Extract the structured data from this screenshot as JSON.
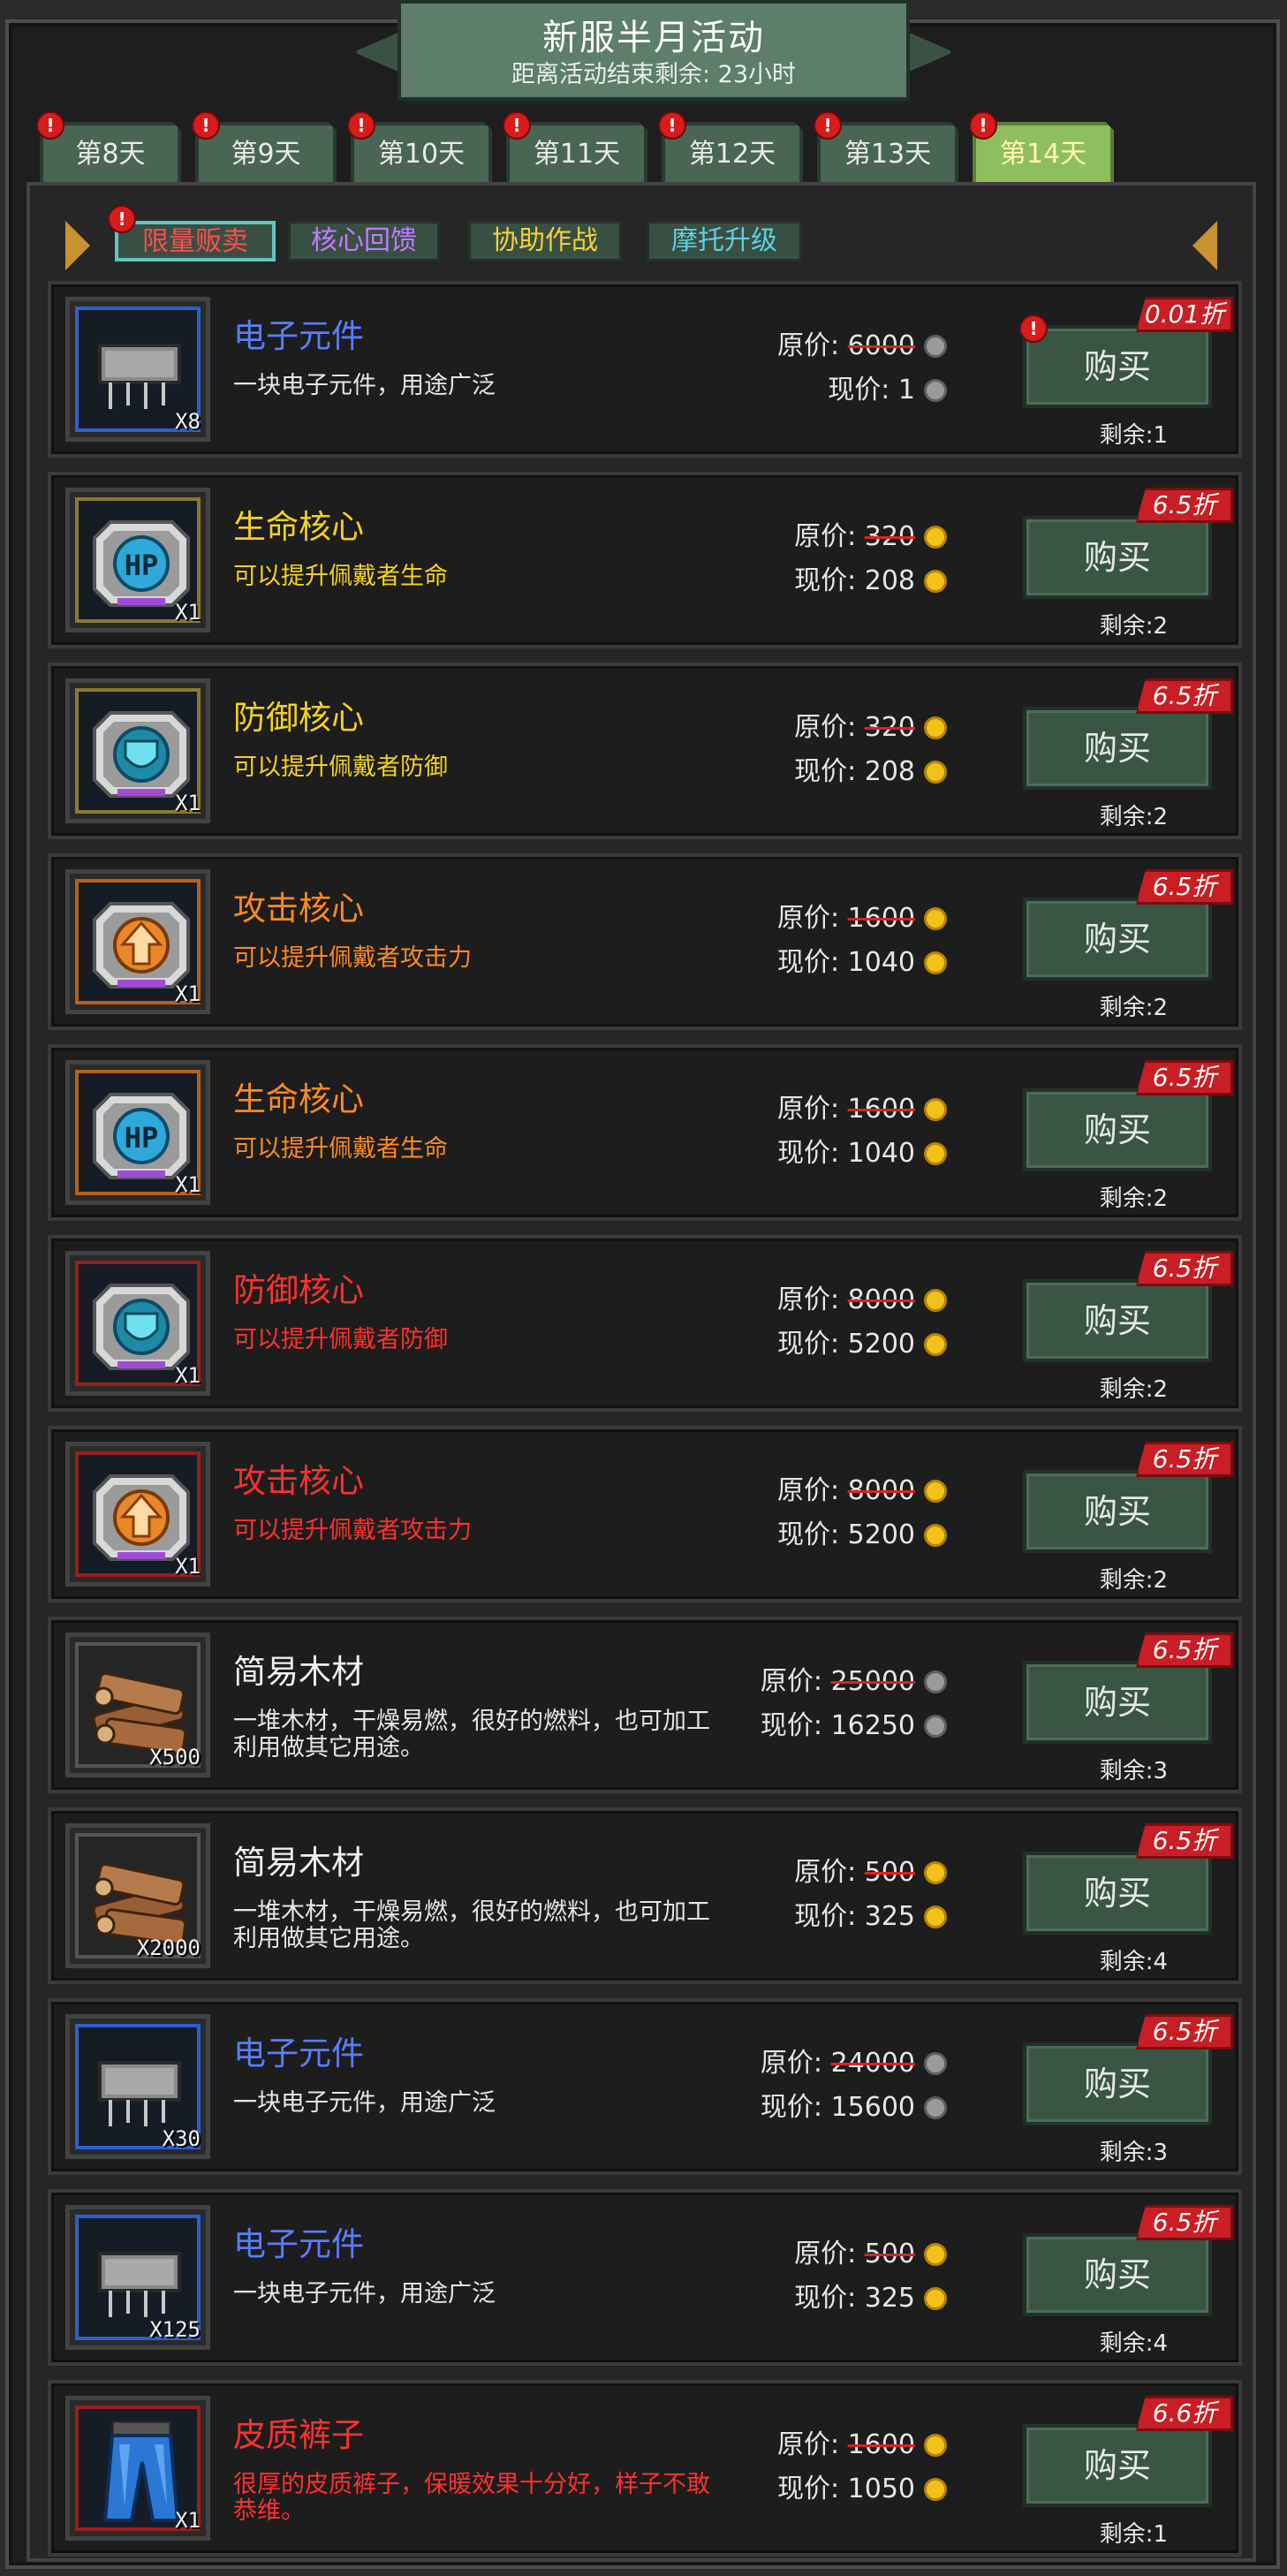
{
  "header": {
    "title": "新服半月活动",
    "subtitle": "距离活动结束剩余: 23小时"
  },
  "day_tabs": [
    {
      "label": "第8天",
      "active": false
    },
    {
      "label": "第9天",
      "active": false
    },
    {
      "label": "第10天",
      "active": false
    },
    {
      "label": "第11天",
      "active": false
    },
    {
      "label": "第12天",
      "active": false
    },
    {
      "label": "第13天",
      "active": false
    },
    {
      "label": "第14天",
      "active": true
    }
  ],
  "badge_symbol": "!",
  "sub_tabs": [
    {
      "label": "限量贩卖",
      "color": "#ff4d4d",
      "active": true
    },
    {
      "label": "核心回馈",
      "color": "#c07bff",
      "active": false
    },
    {
      "label": "协助作战",
      "color": "#f2d23a",
      "active": false
    },
    {
      "label": "摩托升级",
      "color": "#5fd0e0",
      "active": false
    }
  ],
  "labels": {
    "original_price": "原价:",
    "current_price": "现价:",
    "buy": "购买",
    "remaining": "剩余:"
  },
  "items": [
    {
      "name": "电子元件",
      "desc": "一块电子元件，用途广泛",
      "color": "#5b7cff",
      "icon": "chip-icon",
      "frame": "#2c5fcf",
      "qty": "X8",
      "original": "6000",
      "current": "1",
      "coin": "silver",
      "discount": "0.01折",
      "remaining": "1",
      "alert": true
    },
    {
      "name": "生命核心",
      "desc": "可以提升佩戴者生命",
      "color": "#f1d21c",
      "icon": "hp-core-icon",
      "frame": "#8a7a2c",
      "qty": "X1",
      "original": "320",
      "current": "208",
      "coin": "gold",
      "discount": "6.5折",
      "remaining": "2",
      "alert": false
    },
    {
      "name": "防御核心",
      "desc": "可以提升佩戴者防御",
      "color": "#f1d21c",
      "icon": "defense-core-icon",
      "frame": "#8a7a2c",
      "qty": "X1",
      "original": "320",
      "current": "208",
      "coin": "gold",
      "discount": "6.5折",
      "remaining": "2",
      "alert": false
    },
    {
      "name": "攻击核心",
      "desc": "可以提升佩戴者攻击力",
      "color": "#ff8a1e",
      "icon": "attack-core-icon",
      "frame": "#b5601c",
      "qty": "X1",
      "original": "1600",
      "current": "1040",
      "coin": "gold",
      "discount": "6.5折",
      "remaining": "2",
      "alert": false
    },
    {
      "name": "生命核心",
      "desc": "可以提升佩戴者生命",
      "color": "#ff8a1e",
      "icon": "hp-core-icon",
      "frame": "#b5601c",
      "qty": "X1",
      "original": "1600",
      "current": "1040",
      "coin": "gold",
      "discount": "6.5折",
      "remaining": "2",
      "alert": false
    },
    {
      "name": "防御核心",
      "desc": "可以提升佩戴者防御",
      "color": "#ff3030",
      "icon": "defense-core-icon",
      "frame": "#9c1d1d",
      "qty": "X1",
      "original": "8000",
      "current": "5200",
      "coin": "gold",
      "discount": "6.5折",
      "remaining": "2",
      "alert": false
    },
    {
      "name": "攻击核心",
      "desc": "可以提升佩戴者攻击力",
      "color": "#ff3030",
      "icon": "attack-core-icon",
      "frame": "#9c1d1d",
      "qty": "X1",
      "original": "8000",
      "current": "5200",
      "coin": "gold",
      "discount": "6.5折",
      "remaining": "2",
      "alert": false
    },
    {
      "name": "简易木材",
      "desc": "一堆木材，干燥易燃，很好的燃料，也可加工利用做其它用途。",
      "color": "#f0f0f0",
      "icon": "wood-icon",
      "frame": "#555555",
      "qty": "X500",
      "original": "25000",
      "current": "16250",
      "coin": "silver",
      "discount": "6.5折",
      "remaining": "3",
      "alert": false
    },
    {
      "name": "简易木材",
      "desc": "一堆木材，干燥易燃，很好的燃料，也可加工利用做其它用途。",
      "color": "#f0f0f0",
      "icon": "wood-icon",
      "frame": "#555555",
      "qty": "X2000",
      "original": "500",
      "current": "325",
      "coin": "gold",
      "discount": "6.5折",
      "remaining": "4",
      "alert": false
    },
    {
      "name": "电子元件",
      "desc": "一块电子元件，用途广泛",
      "color": "#5b7cff",
      "icon": "chip-icon",
      "frame": "#2c5fcf",
      "qty": "X30",
      "original": "24000",
      "current": "15600",
      "coin": "silver",
      "discount": "6.5折",
      "remaining": "3",
      "alert": false
    },
    {
      "name": "电子元件",
      "desc": "一块电子元件，用途广泛",
      "color": "#5b7cff",
      "icon": "chip-icon",
      "frame": "#2c5fcf",
      "qty": "X125",
      "original": "500",
      "current": "325",
      "coin": "gold",
      "discount": "6.5折",
      "remaining": "4",
      "alert": false
    },
    {
      "name": "皮质裤子",
      "desc": "很厚的皮质裤子，保暖效果十分好，样子不敢恭维。",
      "color": "#ff3030",
      "icon": "pants-icon",
      "frame": "#9c1d1d",
      "qty": "X1",
      "original": "1600",
      "current": "1050",
      "coin": "gold",
      "discount": "6.6折",
      "remaining": "1",
      "alert": false
    }
  ]
}
